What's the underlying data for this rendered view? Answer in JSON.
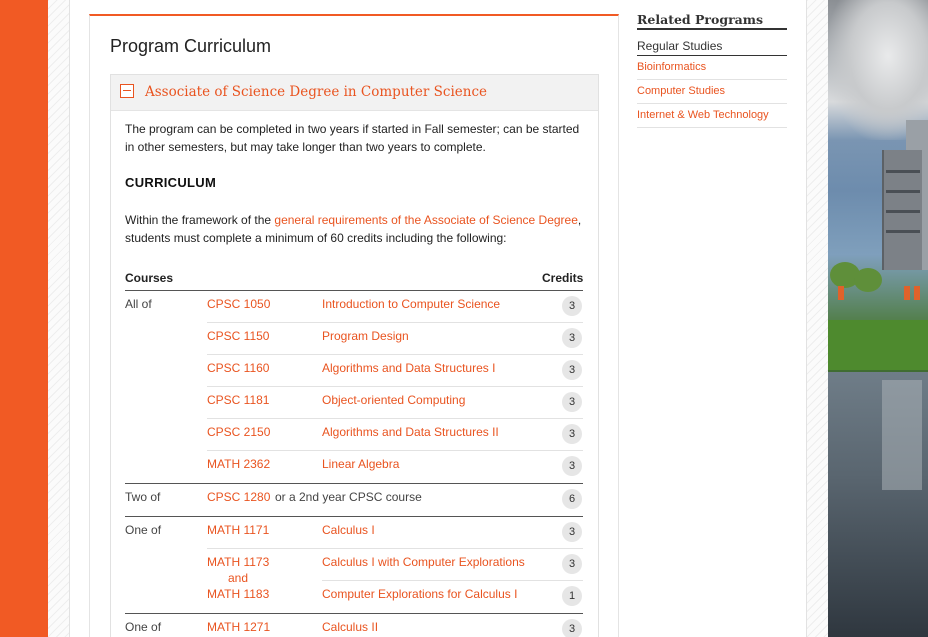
{
  "main": {
    "heading": "Program Curriculum",
    "accordion": {
      "title": "Associate of Science Degree in Computer Science",
      "intro": "The program can be completed in two years if started in Fall semester; can be started in other semesters, but may take longer than two years to complete.",
      "section_heading": "CURRICULUM",
      "framework_before": "Within the framework of the ",
      "framework_link": "general requirements of the Associate of Science Degree",
      "framework_after": ", students must complete a minimum of 60 credits including the following:",
      "table": {
        "courses_header": "Courses",
        "credits_header": "Credits",
        "groups": [
          {
            "label": "All of",
            "rows": [
              {
                "code": "CPSC 1050",
                "title": "Introduction to Computer Science",
                "credits": "3"
              },
              {
                "code": "CPSC 1150",
                "title": "Program Design",
                "credits": "3"
              },
              {
                "code": "CPSC 1160",
                "title": "Algorithms and Data Structures I",
                "credits": "3"
              },
              {
                "code": "CPSC 1181",
                "title": "Object-oriented Computing",
                "credits": "3"
              },
              {
                "code": "CPSC 2150",
                "title": "Algorithms and Data Structures II",
                "credits": "3"
              },
              {
                "code": "MATH 2362",
                "title": "Linear Algebra",
                "credits": "3"
              }
            ]
          },
          {
            "label": "Two of",
            "rows": [
              {
                "code": "CPSC 1280",
                "suffix": "or a 2nd year CPSC course",
                "credits": "6"
              }
            ]
          },
          {
            "label": "One of",
            "rows": [
              {
                "code": "MATH 1171",
                "title": "Calculus I",
                "credits": "3"
              },
              {
                "code": "MATH 1173",
                "and": "and",
                "code2": "MATH 1183",
                "title": "Calculus I with Computer Explorations",
                "credits": "3",
                "title2": "Computer Explorations for Calculus I",
                "credits2": "1"
              }
            ]
          },
          {
            "label": "One of",
            "rows": [
              {
                "code": "MATH 1271",
                "title": "Calculus II",
                "credits": "3"
              }
            ]
          }
        ]
      }
    }
  },
  "sidebar": {
    "title": "Related Programs",
    "subheading": "Regular Studies",
    "links": [
      "Bioinformatics",
      "Computer Studies",
      "Internet & Web Technology"
    ]
  },
  "colors": {
    "accent": "#f15a24",
    "link": "#e95420"
  },
  "icons": {
    "accordion_toggle": "minus-box-icon"
  }
}
